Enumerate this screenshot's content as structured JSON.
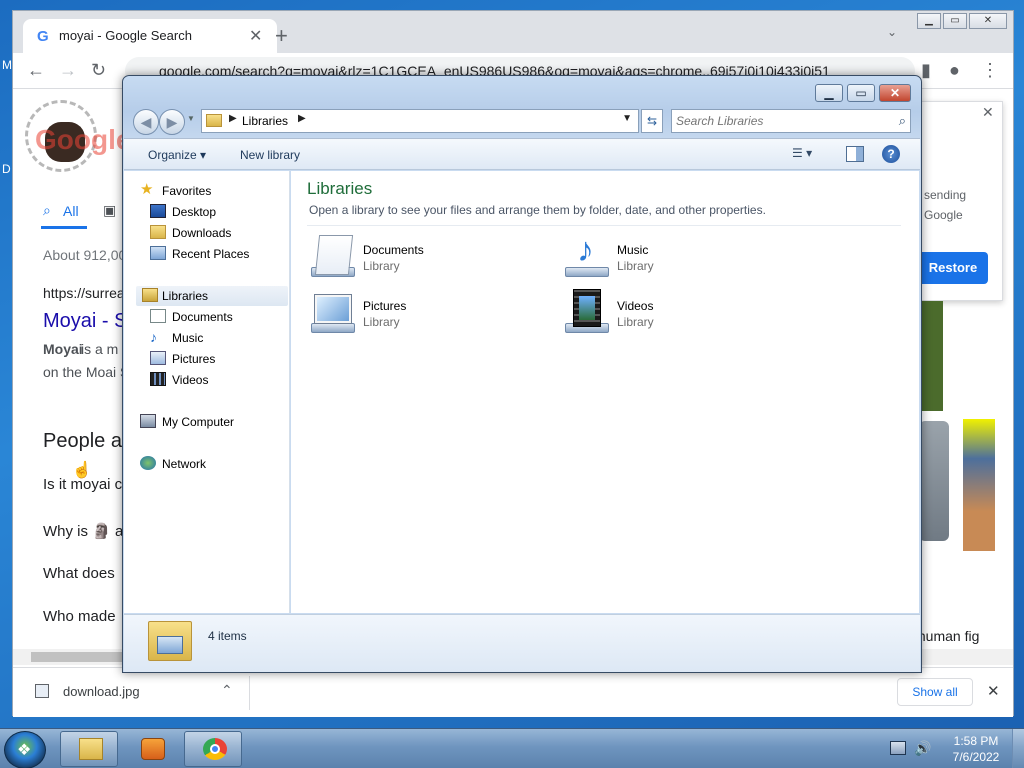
{
  "desktop": {
    "label_m": "M",
    "label_d": "D"
  },
  "chrome": {
    "tab_title": "moyai - Google Search",
    "url": "google.com/search?q=moyai&rlz=1C1GCEA_enUS986US986&oq=moyai&aqs=chrome..69i57j0i10j433i0i51",
    "serp": {
      "all_tab": "All",
      "result_stats": "About 912,00",
      "cite": "https://surrea",
      "result_title": "Moyai - S",
      "snippet_bold": "Moyai",
      "snippet_rest": " is a m",
      "snippet_line2": "on the Moai S",
      "paa_heading": "People a",
      "paa_q1": "Is it moyai c",
      "paa_q2": "Why is 🗿 a",
      "paa_q3": "What does",
      "paa_q4": "Who made"
    },
    "right_panel": {
      "line1": "sending",
      "line2": "Google",
      "restore_label": "Restore",
      "close": "✕"
    },
    "right_caption": "c human fig",
    "downloads": {
      "file_name": "download.jpg",
      "show_all": "Show all",
      "close": "✕"
    }
  },
  "explorer": {
    "address": {
      "crumb": "Libraries"
    },
    "search_placeholder": "Search Libraries",
    "toolbar": {
      "organize": "Organize",
      "new_library": "New library"
    },
    "nav": {
      "favorites": "Favorites",
      "desktop": "Desktop",
      "downloads": "Downloads",
      "recent_places": "Recent Places",
      "libraries": "Libraries",
      "documents": "Documents",
      "music": "Music",
      "pictures": "Pictures",
      "videos": "Videos",
      "my_computer": "My Computer",
      "network": "Network"
    },
    "content": {
      "title": "Libraries",
      "subtitle": "Open a library to see your files and arrange them by folder, date, and other properties.",
      "items": [
        {
          "name": "Documents",
          "type": "Library"
        },
        {
          "name": "Music",
          "type": "Library"
        },
        {
          "name": "Pictures",
          "type": "Library"
        },
        {
          "name": "Videos",
          "type": "Library"
        }
      ]
    },
    "details": {
      "count": "4 items"
    }
  },
  "taskbar": {
    "time": "1:58 PM",
    "date": "7/6/2022"
  }
}
